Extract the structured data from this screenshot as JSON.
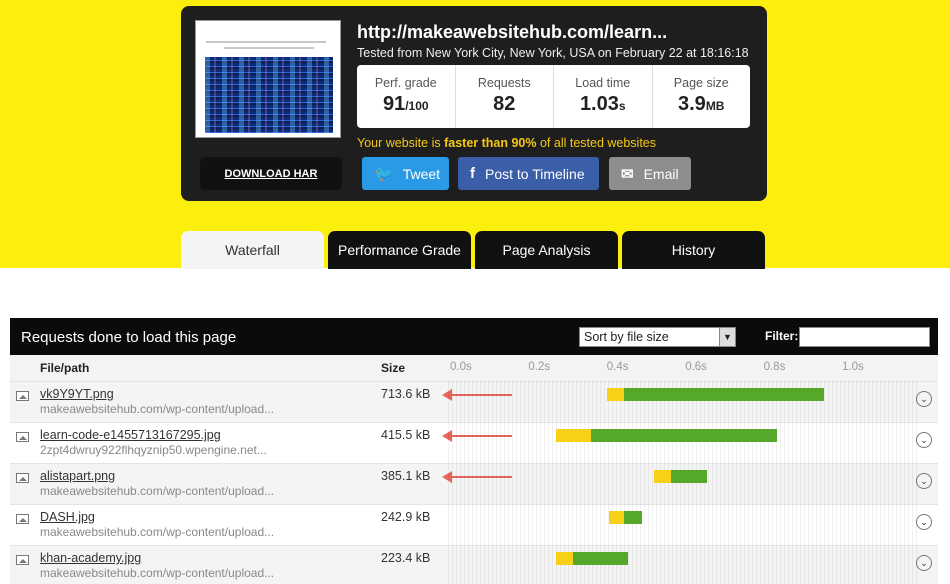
{
  "report": {
    "url": "http://makeawebsitehub.com/learn...",
    "tested": "Tested from New York City, New York, USA on February 22 at 18:16:18",
    "faster_prefix": "Your website is ",
    "faster_bold": "faster than 90%",
    "faster_suffix": " of all tested websites"
  },
  "stats": [
    {
      "label": "Perf. grade",
      "value": "91",
      "unit": "/100"
    },
    {
      "label": "Requests",
      "value": "82",
      "unit": ""
    },
    {
      "label": "Load time",
      "value": "1.03",
      "unit": "s"
    },
    {
      "label": "Page size",
      "value": "3.9",
      "unit": "MB"
    }
  ],
  "actions": {
    "download_har": "DOWNLOAD HAR",
    "tweet": "Tweet",
    "facebook": "Post to Timeline",
    "email": "Email"
  },
  "tabs": [
    "Waterfall",
    "Performance Grade",
    "Page Analysis",
    "History"
  ],
  "waterfall": {
    "title": "Requests done to load this page",
    "sort": "Sort by file size",
    "filter_label": "Filter:",
    "col_file": "File/path",
    "col_size": "Size",
    "ticks": [
      "0.0s",
      "0.2s",
      "0.4s",
      "0.6s",
      "0.8s",
      "1.0s"
    ],
    "rows": [
      {
        "name": "vk9Y9YT.png",
        "path": "makeawebsitehub.com/wp-content/upload...",
        "size": "713.6 kB",
        "start_s": 0.4,
        "wait_s": 0.045,
        "end_s": 0.955,
        "arrow": true
      },
      {
        "name": "learn-code-e1455713167295.jpg",
        "path": "2zpt4dwruy922flhqyznip50.wpengine.net...",
        "size": "415.5 kB",
        "start_s": 0.27,
        "wait_s": 0.09,
        "end_s": 0.835,
        "arrow": true
      },
      {
        "name": "alistapart.png",
        "path": "makeawebsitehub.com/wp-content/upload...",
        "size": "385.1 kB",
        "start_s": 0.52,
        "wait_s": 0.045,
        "end_s": 0.655,
        "arrow": true
      },
      {
        "name": "DASH.jpg",
        "path": "makeawebsitehub.com/wp-content/upload...",
        "size": "242.9 kB",
        "start_s": 0.405,
        "wait_s": 0.04,
        "end_s": 0.49,
        "arrow": false
      },
      {
        "name": "khan-academy.jpg",
        "path": "makeawebsitehub.com/wp-content/upload...",
        "size": "223.4 kB",
        "start_s": 0.27,
        "wait_s": 0.045,
        "end_s": 0.455,
        "arrow": false
      }
    ]
  },
  "colors": {
    "background": "#fcee0d",
    "wait": "#f7d118",
    "receive": "#55a82a",
    "accent": "#f6c813",
    "arrow": "#e8675a"
  },
  "icons": [
    "twitter-bird-icon",
    "facebook-icon",
    "envelope-icon",
    "image-file-icon",
    "expand-chevron-icon"
  ]
}
